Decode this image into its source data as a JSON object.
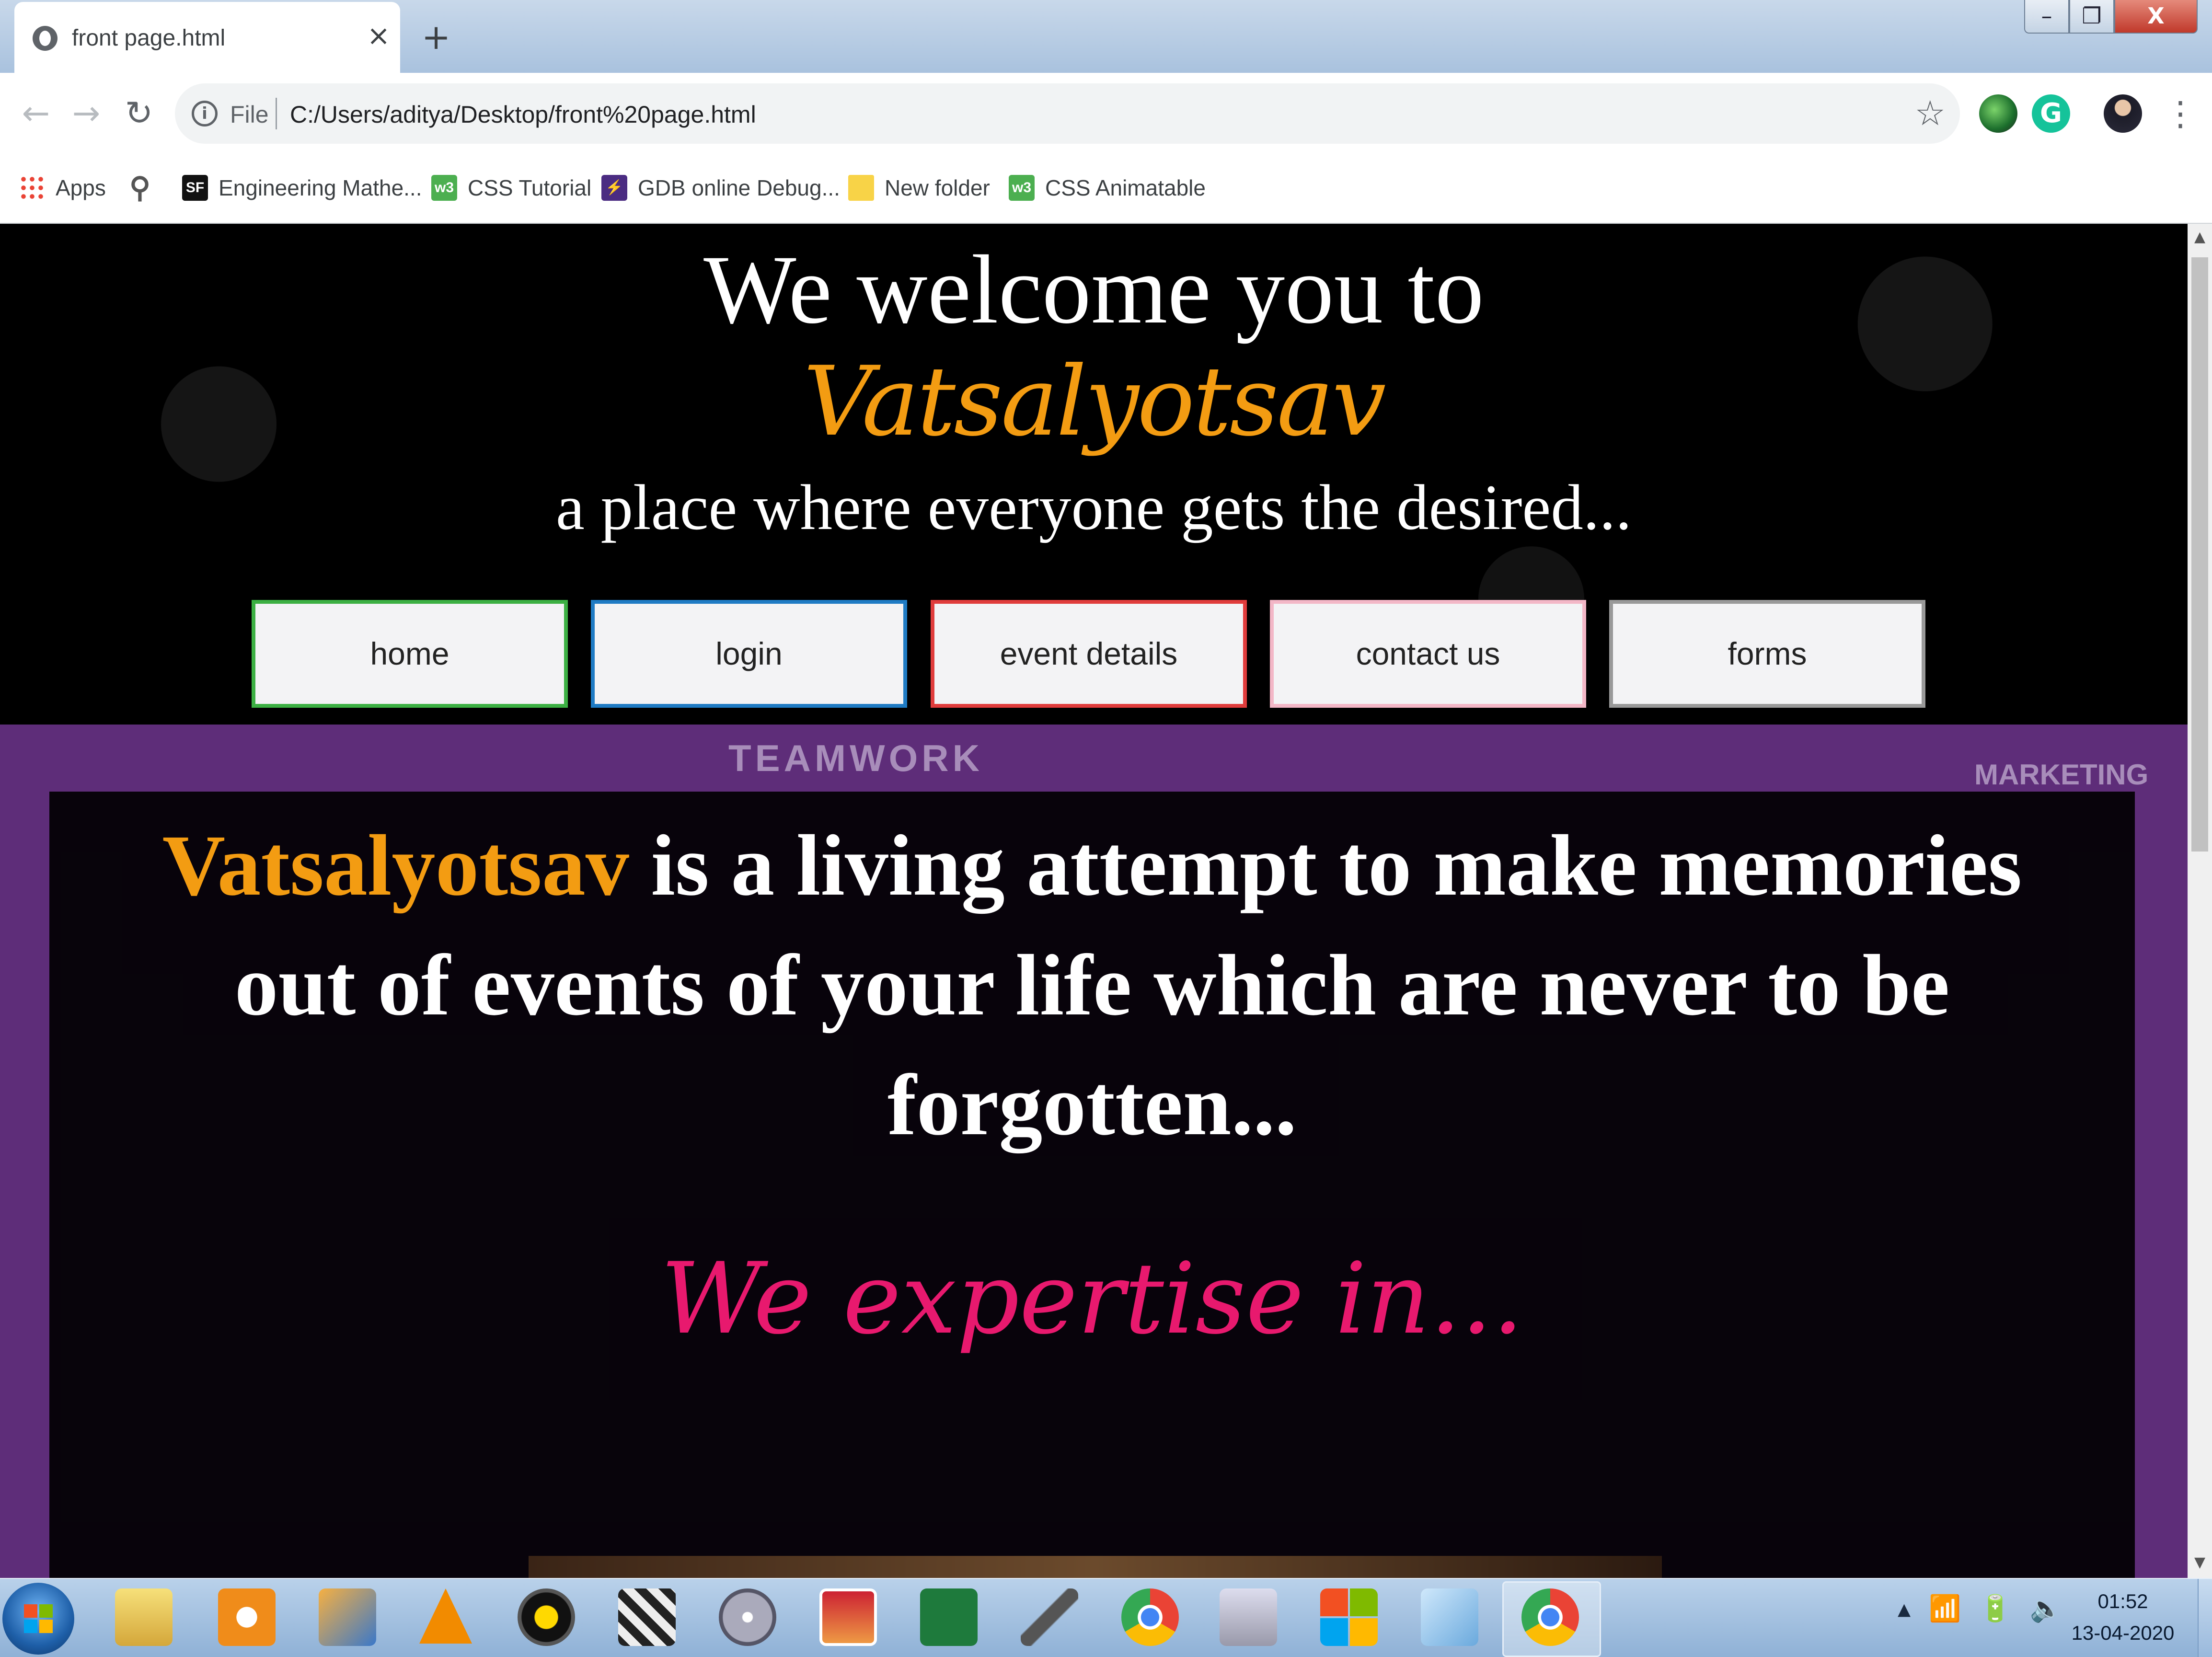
{
  "tab": {
    "title": "front page.html",
    "close": "×",
    "new_tab": "+"
  },
  "window": {
    "minimize": "–",
    "restore": "❐",
    "close": "X"
  },
  "toolbar": {
    "back": "←",
    "forward": "→",
    "reload": "↻",
    "scheme": "File",
    "url": "C:/Users/aditya/Desktop/front%20page.html",
    "star": "☆",
    "menu": "⋮",
    "grammarly": "G"
  },
  "bookmarks": [
    {
      "label": "Apps",
      "icon": "apps-grid-icon"
    },
    {
      "label": "",
      "icon": "search-icon"
    },
    {
      "label": "Engineering Mathe...",
      "icon": "sf-icon",
      "icon_text": "SF"
    },
    {
      "label": "CSS Tutorial",
      "icon": "w3schools-icon",
      "icon_text": "w3"
    },
    {
      "label": "GDB online Debug...",
      "icon": "gdb-icon",
      "icon_text": "⚡"
    },
    {
      "label": "New folder",
      "icon": "folder-icon"
    },
    {
      "label": "CSS Animatable",
      "icon": "w3schools-icon",
      "icon_text": "w3"
    }
  ],
  "hero": {
    "title": "We welcome you to",
    "brand": "Vatsalyotsav",
    "tagline": "a place where everyone gets the desired..."
  },
  "nav": {
    "home": "home",
    "login": "login",
    "events": "event details",
    "contact": "contact us",
    "forms": "forms"
  },
  "doodles": {
    "teamwork": "TEAMWORK",
    "marketing": "MARKETING"
  },
  "about": {
    "brand": "Vatsalyotsav",
    "text": " is a living attempt to make memories out of events of your life which are never to be forgotten..."
  },
  "expertise": {
    "heading": "We expertise in..."
  },
  "scrollbar": {
    "up": "▲",
    "down": "▼"
  },
  "taskbar": {
    "tray_icons": [
      "▴",
      "📶",
      "🔋",
      "🔈"
    ],
    "time": "01:52",
    "date": "13-04-2020"
  },
  "colors": {
    "brand_orange": "#f39c12",
    "expertise_pink": "#e8196e",
    "band_purple": "#5e2d79"
  }
}
